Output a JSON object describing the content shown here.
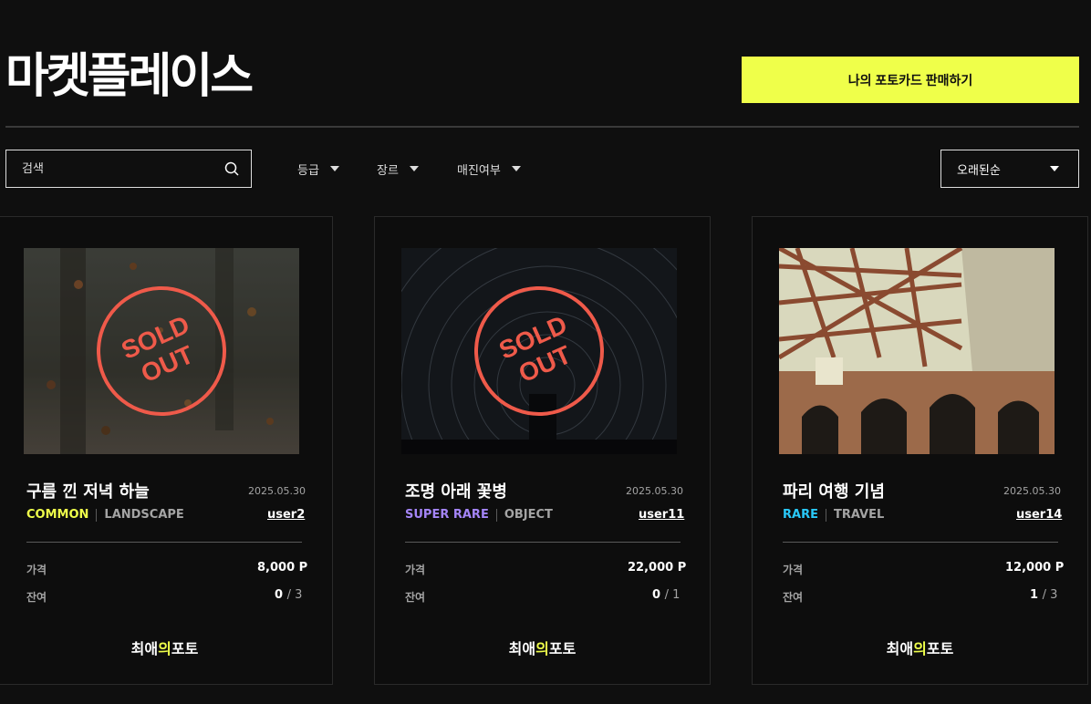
{
  "header": {
    "title": "마켓플레이스",
    "sell_button_label": "나의 포토카드 판매하기"
  },
  "search": {
    "placeholder": "검색"
  },
  "filters": [
    {
      "label": "등급"
    },
    {
      "label": "장르"
    },
    {
      "label": "매진여부"
    }
  ],
  "sort": {
    "selected": "오래된순"
  },
  "colors": {
    "accent": "#efff4a",
    "soldout": "#ef5a4a",
    "common": "#efff4a",
    "super_rare": "#a485f8",
    "rare": "#29c9f9"
  },
  "labels": {
    "price": "가격",
    "remaining": "잔여",
    "sold_out_line1": "SOLD",
    "sold_out_line2": "OUT"
  },
  "brand": {
    "part1": "최애",
    "part2": "의",
    "part3": "포토"
  },
  "cards": [
    {
      "title": "구름 낀 저녁 하늘",
      "date": "2025.05.30",
      "grade": "COMMON",
      "grade_color": "#efff4a",
      "genre": "LANDSCAPE",
      "owner": "user2",
      "price": "8,000 P",
      "remaining": "0",
      "total": "3",
      "sold_out": true
    },
    {
      "title": "조명 아래 꽃병",
      "date": "2025.05.30",
      "grade": "SUPER RARE",
      "grade_color": "#a485f8",
      "genre": "OBJECT",
      "owner": "user11",
      "price": "22,000 P",
      "remaining": "0",
      "total": "1",
      "sold_out": true
    },
    {
      "title": "파리 여행 기념",
      "date": "2025.05.30",
      "grade": "RARE",
      "grade_color": "#29c9f9",
      "genre": "TRAVEL",
      "owner": "user14",
      "price": "12,000 P",
      "remaining": "1",
      "total": "3",
      "sold_out": false
    }
  ]
}
